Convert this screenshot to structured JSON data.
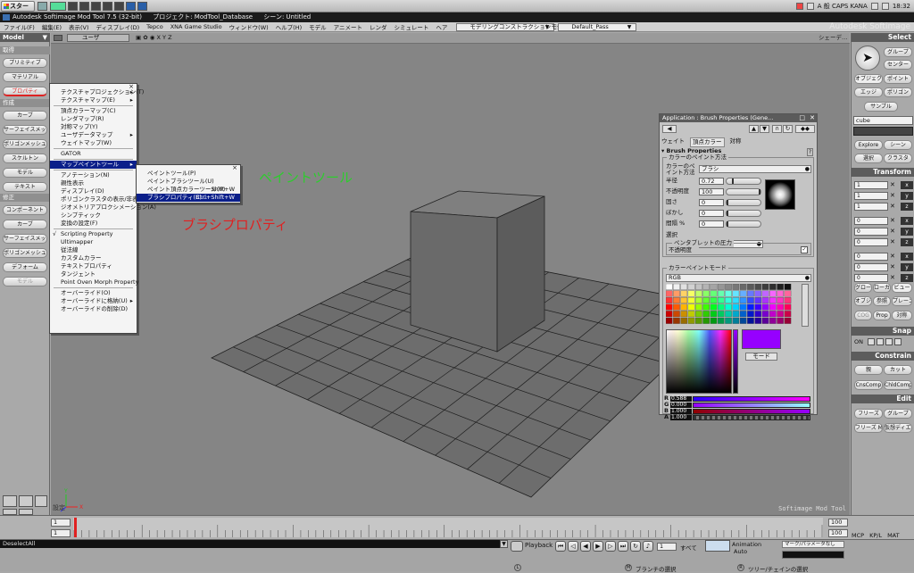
{
  "taskbar": {
    "start_label": "スタート",
    "tray_text": "A 般 CAPS KANA",
    "clock": "18:32"
  },
  "window": {
    "title": "Autodesk Softimage Mod Tool 7.5 (32-bit)",
    "project": "プロジェクト: ModTool_Database",
    "scene": "シーン: Untitled"
  },
  "menubar": {
    "items": [
      "ファイル(F)",
      "編集(E)",
      "表示(V)",
      "ディスプレイ(D)",
      "Tepco",
      "XNA Game Studio",
      "ウィンドウ(W)",
      "ヘルプ(H)",
      "モデル",
      "アニメート",
      "レンダ",
      "シミュレート",
      "ヘア"
    ],
    "mode_combo": "モデリングコンストラクションモード",
    "pass_combo": "Default_Pass"
  },
  "brand": "Autodesk Softimage",
  "left_panel": {
    "header": "Model",
    "sections": {
      "get": "取得",
      "create": "作成",
      "modify": "修正"
    },
    "get_buttons": [
      "プリミティブ",
      "マテリアル",
      "プロパティ"
    ],
    "create_buttons": [
      "カーブ",
      "サーフェイスメッシュ",
      "ポリゴンメッシュ",
      "スケルトン",
      "モデル",
      "テキスト"
    ],
    "modify_buttons": [
      "コンポーネント",
      "カーブ",
      "サーフェイスメッシュ",
      "ポリゴンメッシュ",
      "デフォーム",
      "モデル"
    ]
  },
  "viewport": {
    "camera": "ユーザ",
    "axes_text": "X Y Z",
    "shade_label": "シェーデ…",
    "footer": "Softimage Mod Tool",
    "label": "設定",
    "gizmo_y": "Y",
    "gizmo_x": "X"
  },
  "annotations": {
    "paint_tool": "ペイントツール",
    "brush_properties": "ブラシプロパティ",
    "paint_color": "#2ecc2e",
    "brush_color": "#e02020"
  },
  "context_menu": {
    "items": [
      {
        "label": "テクスチャプロジェクション(T)",
        "sub": true
      },
      {
        "label": "テクスチャマップ(E)",
        "sub": true
      },
      {
        "sep": true
      },
      {
        "label": "頂点カラーマップ(C)"
      },
      {
        "label": "レンダマップ(R)"
      },
      {
        "label": "対称マップ(Y)"
      },
      {
        "label": "ユーザデータマップ",
        "sub": true
      },
      {
        "label": "ウェイトマップ(W)"
      },
      {
        "sep": true
      },
      {
        "label": "GATOR"
      },
      {
        "sep": true
      },
      {
        "label": "マップペイントツール",
        "sub": true,
        "selected": true
      },
      {
        "sep": true
      },
      {
        "label": "アノテーション(N)"
      },
      {
        "label": "親性表示"
      },
      {
        "label": "ディスプレイ(D)"
      },
      {
        "label": "ポリゴンクラスタの表示/非表示"
      },
      {
        "label": "ジオメトリアプロクシメーション(A)"
      },
      {
        "label": "シンプティック"
      },
      {
        "label": "変換の設定(F)"
      },
      {
        "sep": true
      },
      {
        "label": "Scripting Property",
        "check": true
      },
      {
        "label": "Ultimapper"
      },
      {
        "label": "従法線"
      },
      {
        "label": "カスタムカラー"
      },
      {
        "label": "テキストプロパティ"
      },
      {
        "label": "タンジェント"
      },
      {
        "label": "Point Oven Morph Property"
      },
      {
        "sep": true
      },
      {
        "label": "オーバーライド(O)"
      },
      {
        "label": "オーバーライドに格納(U)",
        "sub": true
      },
      {
        "label": "オーバーライドの削除(D)"
      }
    ]
  },
  "submenu": {
    "items": [
      {
        "label": "ペイントツール(P)",
        "shortcut": ""
      },
      {
        "label": "ペイントブラシツール(U)",
        "shortcut": ""
      },
      {
        "label": "ペイント頂点カラーツール(V)",
        "shortcut": "Shift+W"
      },
      {
        "label": "ブラシプロパティ(B)...",
        "shortcut": "Ctrl+Shift+W",
        "selected": true
      }
    ]
  },
  "brush_window": {
    "title": "Application : Brush Properties (Gene...",
    "tabs": [
      "ウェイト",
      "頂点カラー",
      "対称"
    ],
    "section": "Brush Properties",
    "paint_method_group": "カラーのペイント方法",
    "color_paint_method_label": "カラーのペイント方法",
    "color_paint_method_value": "ブラシ",
    "rows": [
      {
        "label": "半径",
        "value": "0.72",
        "fill": 0.18
      },
      {
        "label": "不透明度",
        "value": "100",
        "fill": 1.0
      },
      {
        "label": "固さ",
        "value": "0",
        "fill": 0.0
      },
      {
        "label": "ぼかし",
        "value": "0",
        "fill": 0.0
      },
      {
        "label": "間隔 %",
        "value": "0",
        "fill": 0.0
      }
    ],
    "select_label": "選択",
    "select_value": "無視",
    "pen_pressure_label": "ペンタブレットの圧力",
    "pen_opacity_label": "不透明度",
    "color_mode_label": "カラーペイントモード",
    "color_mode_value": "RGB",
    "mode_button": "モード",
    "current_color": "#9600ff",
    "channels": [
      {
        "name": "R",
        "value": "0.588"
      },
      {
        "name": "G",
        "value": "0.000"
      },
      {
        "name": "B",
        "value": "1.000"
      },
      {
        "name": "A",
        "value": "1.000"
      }
    ]
  },
  "right_panel": {
    "select_header": "Select",
    "select_buttons": [
      "グループ",
      "センター",
      "オブジェクト",
      "ポイント",
      "エッジ",
      "ポリゴン",
      "サンプル"
    ],
    "selection_field": "cube",
    "explore_buttons": [
      "Explore",
      "シーン",
      "選択",
      "クラスタ"
    ],
    "transform_header": "Transform",
    "transform_rows": [
      {
        "value": "1",
        "axis": "x"
      },
      {
        "value": "1",
        "axis": "y"
      },
      {
        "value": "1",
        "axis": "z"
      },
      {
        "value": "0",
        "axis": "x"
      },
      {
        "value": "0",
        "axis": "y"
      },
      {
        "value": "0",
        "axis": "z"
      },
      {
        "value": "0",
        "axis": "x"
      },
      {
        "value": "0",
        "axis": "y"
      },
      {
        "value": "0",
        "axis": "z"
      }
    ],
    "ref_buttons": [
      "グローバル",
      "ローカル",
      "ビュー",
      "オブジェクト",
      "参照",
      "プレーン",
      "COG",
      "Prop",
      "対称"
    ],
    "snap_header": "Snap",
    "snap_on": "ON",
    "constrain_header": "Constrain",
    "constrain_buttons": [
      "親",
      "カット",
      "CnsComp",
      "ChldComp"
    ],
    "edit_header": "Edit",
    "edit_buttons": [
      "フリーズ",
      "グループ",
      "フリーズ M",
      "仮想ディエイト"
    ]
  },
  "timeline": {
    "start": "1",
    "start2": "1",
    "end": "100",
    "end2": "100",
    "current": "1"
  },
  "statusbar": {
    "selection": "DeselectAll",
    "playback": "Playback",
    "all_label": "すべて",
    "animation": "Animation",
    "auto_label": "Auto",
    "marker_label": "マーク/パラメータなし",
    "mcp_tabs": [
      "MCP",
      "KP/L",
      "MAT"
    ],
    "status_m": "ブランチの選択",
    "status_r": "ツリー/チェインの選択",
    "status_l": ""
  }
}
